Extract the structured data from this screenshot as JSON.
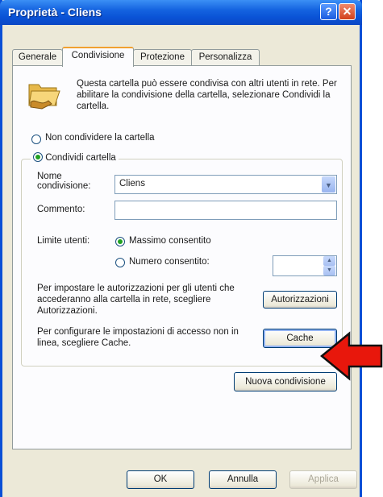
{
  "window": {
    "title": "Proprietà - Cliens"
  },
  "tabs": [
    {
      "label": "Generale",
      "active": false
    },
    {
      "label": "Condivisione",
      "active": true
    },
    {
      "label": "Protezione",
      "active": false
    },
    {
      "label": "Personalizza",
      "active": false
    }
  ],
  "info": {
    "text": "Questa cartella può essere condivisa con altri utenti in rete. Per abilitare la condivisione della cartella, selezionare Condividi la cartella."
  },
  "sharing": {
    "option_no_share": "Non condividere la cartella",
    "option_share": "Condividi cartella",
    "share_name_label": "Nome condivisione:",
    "share_name_value": "Cliens",
    "comment_label": "Commento:",
    "comment_value": "",
    "user_limit_label": "Limite utenti:",
    "limit_max": "Massimo consentito",
    "limit_number": "Numero consentito:",
    "limit_number_value": "",
    "permissions_text": "Per impostare le autorizzazioni per gli utenti che accederanno alla cartella in rete, scegliere Autorizzazioni.",
    "permissions_button": "Autorizzazioni",
    "cache_text": "Per configurare le impostazioni di accesso non in linea, scegliere Cache.",
    "cache_button": "Cache",
    "new_share_button": "Nuova condivisione"
  },
  "footer": {
    "ok": "OK",
    "cancel": "Annulla",
    "apply": "Applica"
  },
  "icons": {
    "folder": "shared-folder-icon",
    "help": "help-icon",
    "close": "close-icon",
    "arrow": "red-arrow-pointer"
  },
  "colors": {
    "titlebar": "#0a52d6",
    "dialog_bg": "#ece9d8",
    "tab_highlight": "#f0a030",
    "arrow": "#e8170c"
  }
}
